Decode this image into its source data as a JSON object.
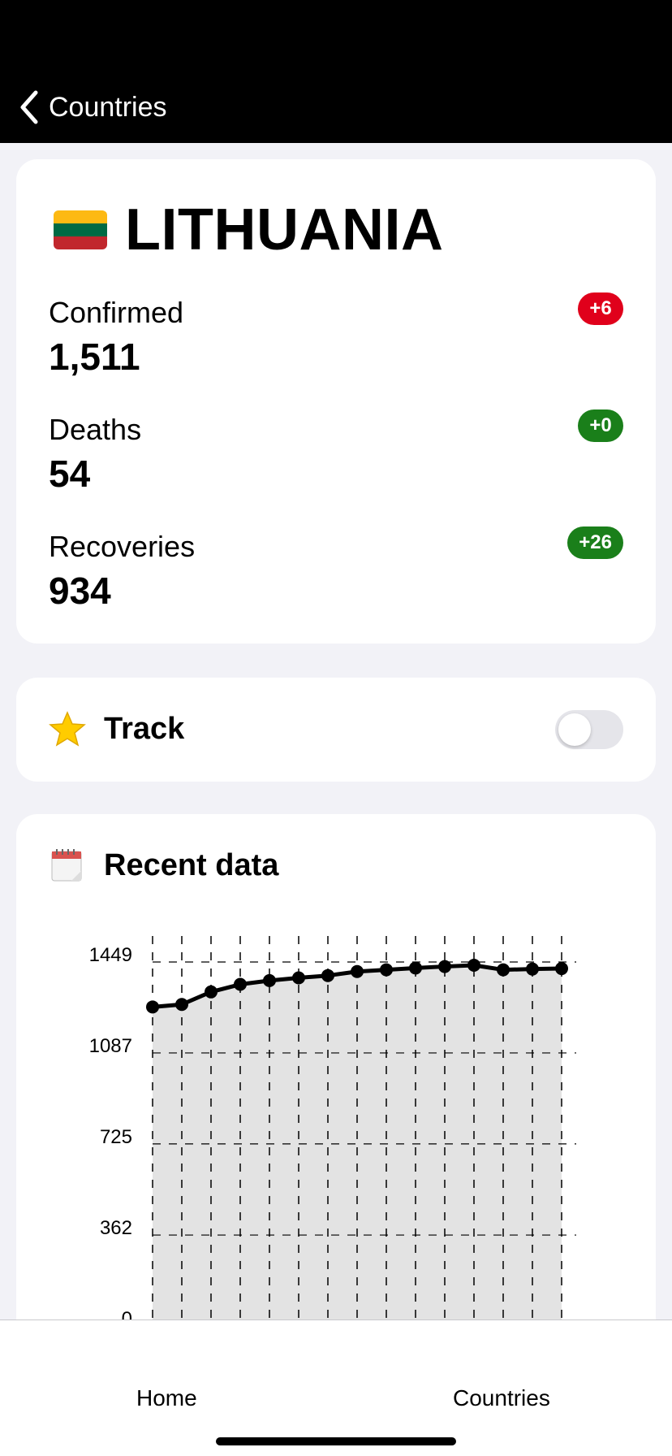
{
  "nav": {
    "back_label": "Countries"
  },
  "country": {
    "name": "LITHUANIA",
    "flag_colors": [
      "#FDB913",
      "#006A44",
      "#C1272D"
    ]
  },
  "stats": [
    {
      "label": "Confirmed",
      "value": "1,511",
      "delta": "+6",
      "delta_color": "#e0001b"
    },
    {
      "label": "Deaths",
      "value": "54",
      "delta": "+0",
      "delta_color": "#1a7f1a"
    },
    {
      "label": "Recoveries",
      "value": "934",
      "delta": "+26",
      "delta_color": "#1a7f1a"
    }
  ],
  "track": {
    "label": "Track",
    "icon": "star-icon",
    "enabled": false
  },
  "recent": {
    "title": "Recent data",
    "icon": "calendar-icon"
  },
  "chart_data": {
    "type": "area",
    "title": "",
    "xlabel": "",
    "ylabel": "",
    "y_ticks": [
      "1449",
      "1087",
      "725",
      "362",
      "0"
    ],
    "ylim": [
      0,
      1449
    ],
    "grid": true,
    "values": [
      1270,
      1280,
      1330,
      1360,
      1375,
      1386,
      1395,
      1411,
      1418,
      1425,
      1431,
      1436,
      1418,
      1421,
      1423
    ]
  },
  "tabs": {
    "home": "Home",
    "countries": "Countries"
  }
}
